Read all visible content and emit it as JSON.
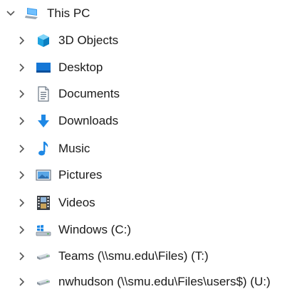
{
  "tree": {
    "root": {
      "label": "This PC",
      "icon": "this-pc-icon",
      "expanded": true
    },
    "children": [
      {
        "label": "3D Objects",
        "icon": "3d-objects-icon"
      },
      {
        "label": "Desktop",
        "icon": "desktop-icon"
      },
      {
        "label": "Documents",
        "icon": "documents-icon"
      },
      {
        "label": "Downloads",
        "icon": "downloads-icon"
      },
      {
        "label": "Music",
        "icon": "music-icon"
      },
      {
        "label": "Pictures",
        "icon": "pictures-icon"
      },
      {
        "label": "Videos",
        "icon": "videos-icon"
      },
      {
        "label": "Windows (C:)",
        "icon": "windows-drive-icon"
      },
      {
        "label": "Teams (\\\\smu.edu\\Files) (T:)",
        "icon": "network-drive-icon"
      },
      {
        "label": "nwhudson (\\\\smu.edu\\Files\\users$) (U:)",
        "icon": "network-drive-icon"
      }
    ]
  },
  "colors": {
    "text": "#1a1a1a",
    "chevron": "#555555",
    "accent": "#1e88e5"
  }
}
